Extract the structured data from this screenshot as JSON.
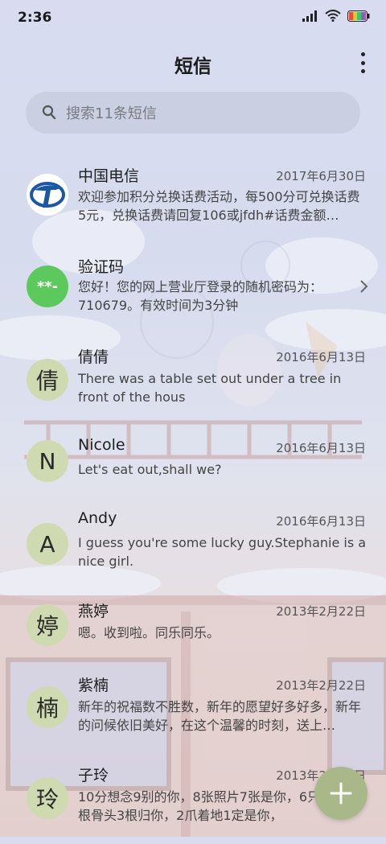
{
  "status_bar": {
    "time": "2:36"
  },
  "header": {
    "title": "短信"
  },
  "search": {
    "placeholder": "搜索11条短信"
  },
  "threads": [
    {
      "avatar": "telecom-logo",
      "sender": "中国电信",
      "date": "2017年6月30日",
      "preview": "欢迎参加积分兑换话费活动，每500分可兑换话费5元，兑换话费请回复106或jfdh#话费金额…"
    },
    {
      "avatar_text": "**-",
      "sender": "验证码",
      "date": "",
      "preview": "您好！您的网上营业厅登录的随机密码为：710679。有效时间为3分钟"
    },
    {
      "avatar_text": "倩",
      "sender": "倩倩",
      "date": "2016年6月13日",
      "preview": "There was a table set out under a tree in front of the hous"
    },
    {
      "avatar_text": "N",
      "sender": "Nicole",
      "date": "2016年6月13日",
      "preview": "Let's eat out,shall we?"
    },
    {
      "avatar_text": "A",
      "sender": "Andy",
      "date": "2016年6月13日",
      "preview": "I guess you're some lucky guy.Stephanie is a nice girl."
    },
    {
      "avatar_text": "婷",
      "sender": "燕婷",
      "date": "2013年2月22日",
      "preview": "嗯。收到啦。同乐同乐。"
    },
    {
      "avatar_text": "楠",
      "sender": "紫楠",
      "date": "2013年2月22日",
      "preview": "新年的祝福数不胜数，新年的愿望好多好多，新年的问候依旧美好，在这个温馨的时刻，送上…"
    },
    {
      "avatar_text": "玲",
      "sender": "子玲",
      "date": "2013年2月22日",
      "preview": "10分想念9别的你，8张照片7张是你，6只像你，4根骨头3根归你，2爪着地1定是你，"
    }
  ],
  "colors": {
    "avatar_bg": "#cfdab0",
    "code_avatar_bg": "#5bc95b",
    "fab_bg": "#a8b888"
  }
}
